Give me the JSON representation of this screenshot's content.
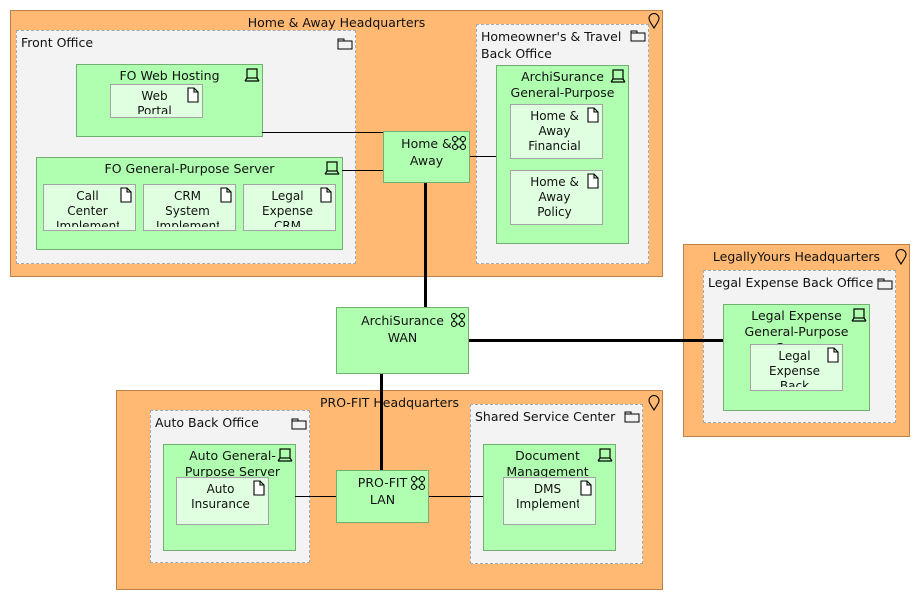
{
  "diagram": {
    "locations": {
      "home_away_hq": "Home & Away Headquarters",
      "legallyyours_hq": "LegallyYours Headquarters",
      "profit_hq": "PRO-FIT Headquarters"
    },
    "groupings": {
      "front_office": "Front Office",
      "homeowners_back_office": "Homeowner's & Travel Back Office",
      "legal_back_office": "Legal Expense Back Office",
      "auto_back_office": "Auto Back Office",
      "shared_service_center": "Shared Service Center"
    },
    "nodes": {
      "fo_web_hosting": "FO Web Hosting",
      "fo_gp_server": "FO General-Purpose Server",
      "archisurance_gp": "ArchiSurance General-Purpose Server",
      "legal_gp": "Legal Expense General-Purpose Server",
      "auto_gp": "Auto General-Purpose Server",
      "dms": "Document Management Server"
    },
    "artifacts": {
      "web_portal": "Web Portal",
      "call_center": "Call Center Implementation",
      "crm_system": "CRM System Implementation",
      "legal_crm": "Legal Expense CRM",
      "ha_financial": "Home & Away Financial",
      "ha_policy": "Home & Away Policy",
      "legal_back": "Legal Expense Back Office",
      "auto_insurance": "Auto Insurance",
      "dms_impl": "DMS Implementation"
    },
    "networks": {
      "home_away": "Home & Away",
      "wan": "ArchiSurance WAN",
      "profit_lan": "PRO-FIT LAN"
    },
    "colors": {
      "location": "#ffb973",
      "grouping": "#f3f3f3",
      "node": "#b0ffb0",
      "artifact": "#e0ffe0"
    }
  }
}
